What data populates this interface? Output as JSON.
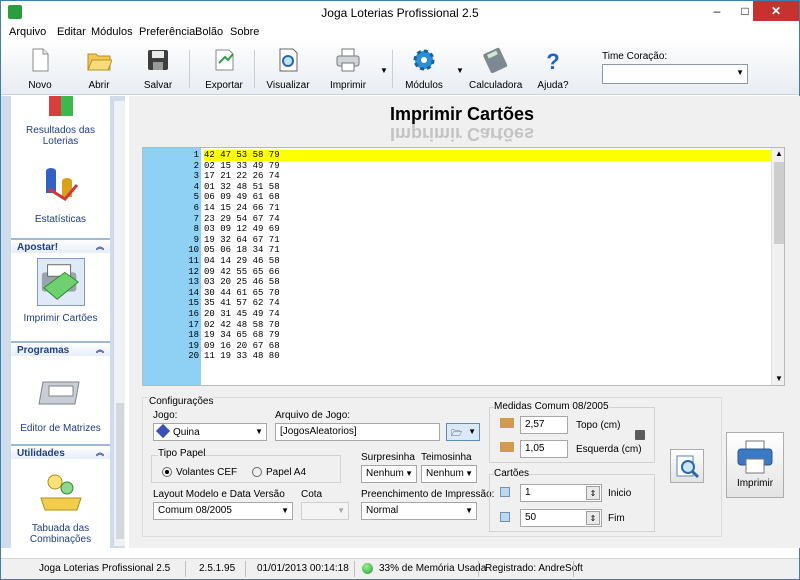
{
  "window": {
    "title": "Joga Loterias Profissional 2.5",
    "minimize": "–",
    "maximize": "□",
    "close": "✕"
  },
  "menu": [
    "Arquivo",
    "Editar",
    "Módulos",
    "Preferência",
    "Bolão",
    "Sobre"
  ],
  "toolbar": {
    "items": [
      {
        "label": "Novo",
        "icon": "new-document-icon"
      },
      {
        "label": "Abrir",
        "icon": "open-folder-icon"
      },
      {
        "label": "Salvar",
        "icon": "save-disk-icon"
      },
      {
        "label": "Exportar",
        "icon": "export-icon"
      },
      {
        "label": "Visualizar",
        "icon": "preview-icon"
      },
      {
        "label": "Imprimir",
        "icon": "printer-icon"
      },
      {
        "label": "Módulos",
        "icon": "gear-icon"
      },
      {
        "label": "Calculadora",
        "icon": "calculator-icon"
      },
      {
        "label": "Ajuda?",
        "icon": "help-icon"
      }
    ],
    "time_label": "Time Coração:",
    "time_value": ""
  },
  "sidebar": {
    "items_top": [
      {
        "label": "Resultados das Loterias",
        "icon": "results-icon"
      },
      {
        "label": "Estatísticas",
        "icon": "statistics-icon"
      }
    ],
    "sections": [
      {
        "title": "Apostar!",
        "items": [
          {
            "label": "Imprimir Cartões",
            "icon": "print-cards-icon"
          }
        ]
      },
      {
        "title": "Programas",
        "items": [
          {
            "label": "Editor de  Matrizes",
            "icon": "matrix-editor-icon"
          }
        ]
      },
      {
        "title": "Utilidades",
        "items": [
          {
            "label": "Tabuada das Combinações",
            "icon": "combinations-icon"
          }
        ]
      }
    ]
  },
  "page": {
    "title": "Imprimir Cartões"
  },
  "games": [
    "42 47 53 58 79",
    "02 15 33 49 79",
    "17 21 22 26 74",
    "01 32 48 51 58",
    "06 09 49 61 68",
    "14 15 24 66 71",
    "23 29 54 67 74",
    "03 09 12 49 69",
    "19 32 64 67 71",
    "05 06 18 34 71",
    "04 14 29 46 58",
    "09 42 55 65 66",
    "03 20 25 46 58",
    "30 44 61 65 70",
    "35 41 57 62 74",
    "20 31 45 49 74",
    "02 42 48 58 70",
    "19 34 65 68 79",
    "09 16 20 67 68",
    "11 19 33 48 80"
  ],
  "config": {
    "group_label": "Configurações",
    "jogo_label": "Jogo:",
    "jogo_value": "Quina",
    "arquivo_label": "Arquivo de Jogo:",
    "arquivo_value": "[JogosAleatorios]",
    "tipo_papel_label": "Tipo Papel",
    "papel_options": [
      "Volantes CEF",
      "Papel A4"
    ],
    "surpresinha_label": "Surpresinha",
    "surpresinha_value": "Nenhum",
    "teimosinha_label": "Teimosinha",
    "teimosinha_value": "Nenhum",
    "layout_label": "Layout Modelo e Data Versão",
    "layout_value": "Comum 08/2005",
    "cota_label": "Cota",
    "cota_value": "",
    "preench_label": "Preenchimento de Impressão:",
    "preench_value": "Normal",
    "medidas_label": "Medidas Comum 08/2005",
    "topo_value": "2,57",
    "topo_label": "Topo (cm)",
    "esquerda_value": "1,05",
    "esquerda_label": "Esquerda (cm)",
    "cartoes_label": "Cartões",
    "inicio_value": "1",
    "inicio_label": "Inicio",
    "fim_value": "50",
    "fim_label": "Fim",
    "print_button": "Imprimir"
  },
  "status": {
    "app": "Joga Loterias Profissional 2.5",
    "version": "2.5.1.95",
    "datetime": "01/01/2013 00:14:18",
    "memory": "33% de Memória Usada",
    "registered": "Registrado: AndreSoft"
  },
  "colors": {
    "accent": "#1d3f8d",
    "highlight": "#ffff00",
    "gutter": "#8fd1f4",
    "close": "#c7312f"
  }
}
